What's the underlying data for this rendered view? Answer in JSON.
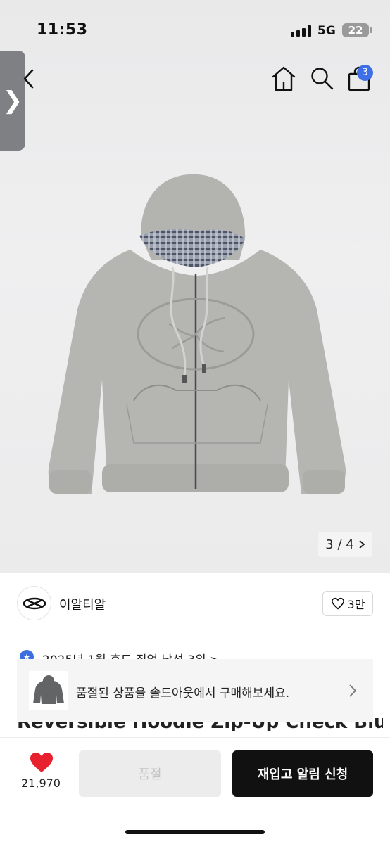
{
  "status_bar": {
    "time": "11:53",
    "network": "5G",
    "battery": "22"
  },
  "nav": {
    "side_tab_glyph": "❯",
    "cart_count": "3",
    "icons": [
      "back-chevron-icon",
      "home-icon",
      "search-icon",
      "shopping-bag-icon"
    ]
  },
  "gallery": {
    "current": "3",
    "total": "4",
    "indicator": "3 / 4"
  },
  "brand": {
    "name": "이알티알",
    "likes": "3만"
  },
  "ranking": {
    "text": "2025년 1월 후드 집업 남성 3위 >"
  },
  "product": {
    "title": "Reversible Hoodie Zip-Up Check Blue"
  },
  "soldout_banner": {
    "text": "품절된 상품을 솔드아웃에서 구매해보세요."
  },
  "actions": {
    "like_count": "21,970",
    "soldout_label": "품절",
    "restock_label": "재입고 알림 신청"
  },
  "colors": {
    "accent_blue": "#3f6fe6",
    "heart_red": "#e8212e",
    "primary_button": "#111111",
    "disabled_button": "#ececec"
  }
}
